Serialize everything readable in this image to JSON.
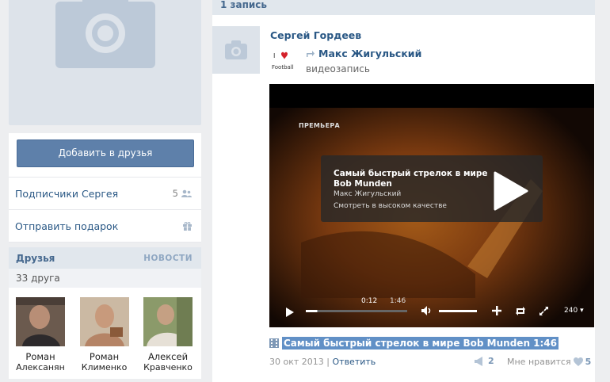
{
  "profile": {
    "add_friend_label": "Добавить в друзья"
  },
  "menu": [
    {
      "label": "Подписчики Сергея",
      "count": "5",
      "icon": "users-icon"
    },
    {
      "label": "Отправить подарок",
      "count": "",
      "icon": "gift-icon"
    }
  ],
  "friends": {
    "title": "Друзья",
    "news_label": "НОВОСТИ",
    "count_label": "33 друга",
    "items": [
      {
        "first": "Роман",
        "last": "Алексанян"
      },
      {
        "first": "Роман",
        "last": "Клименко"
      },
      {
        "first": "Алексей",
        "last": "Кравченко"
      }
    ]
  },
  "wall": {
    "records_label": "1 запись",
    "post": {
      "author": "Сергей Гордеев",
      "repost_source": "Макс Жигульский",
      "repost_type": "видеозапись",
      "video": {
        "premiere_label": "ПРЕМЬЕРА",
        "title": "Самый быстрый стрелок в мире Bob Munden",
        "channel": "Макс Жигульский",
        "hq_label": "Смотреть в высоком качестве",
        "time_current": "0:12",
        "time_duration": "1:46",
        "quality": "240",
        "progress": 0.113
      },
      "video_link": "Самый быстрый стрелок в мире Bob Munden 1:46",
      "date": "30 окт 2013",
      "separator": "|",
      "reply_label": "Ответить",
      "shares": "2",
      "like_label": "Мне нравится",
      "likes": "5"
    }
  },
  "colors": {
    "link": "#2a5885",
    "button": "#5e80aa",
    "highlight": "#6190c6",
    "page_bg": "#edeef0"
  }
}
